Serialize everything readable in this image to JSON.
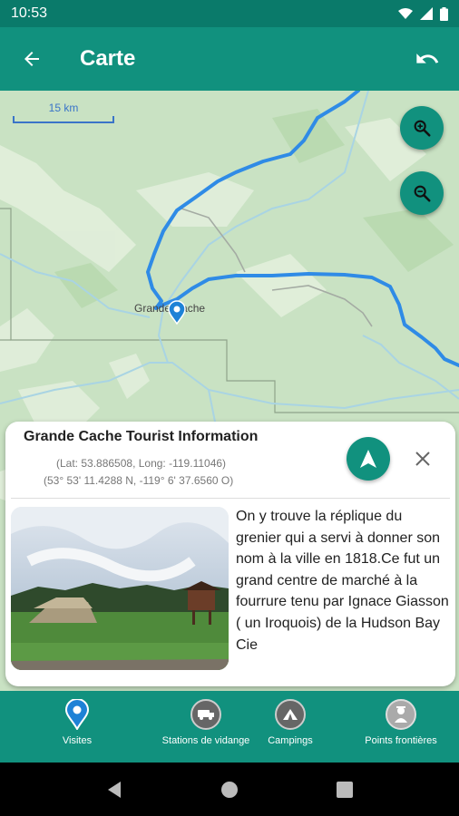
{
  "status": {
    "time": "10:53"
  },
  "appbar": {
    "title": "Carte",
    "back_icon": "arrow-back-icon",
    "action_icon": "undo-icon"
  },
  "map": {
    "scale_label": "15 km",
    "town_label": "Grande Cache",
    "zoom_in_icon": "zoom-in-icon",
    "zoom_out_icon": "zoom-out-icon",
    "route_color": "#2f8be6",
    "marker_color": "#1e82d6"
  },
  "info_card": {
    "name": "Grande Cache Tourist Information",
    "coords_decimal": "(Lat: 53.886508, Long: -119.11046)",
    "coords_dms": "(53° 53' 11.4288 N, -119° 6' 37.6560 O)",
    "description": "On y trouve la réplique du grenier qui a servi à donner son nom à la ville en 1818.Ce fut un grand centre de marché à la fourrure tenu par Ignace Giasson ( un Iroquois) de la Hudson Bay Cie",
    "navigate_icon": "navigation-arrow-icon",
    "close_icon": "close-icon"
  },
  "bottom_nav": [
    {
      "label": "Visites",
      "icon": "location-pin-icon",
      "active": true
    },
    {
      "label": "Stations de vidange",
      "icon": "rv-dump-icon",
      "active": false
    },
    {
      "label": "Campings",
      "icon": "tent-icon",
      "active": false
    },
    {
      "label": "Points frontières",
      "icon": "border-officer-icon",
      "active": false
    }
  ],
  "colors": {
    "primary": "#11917e",
    "status_bar": "#0a7a6a",
    "map_land": "#c9e2c3",
    "route": "#2f8be6"
  }
}
